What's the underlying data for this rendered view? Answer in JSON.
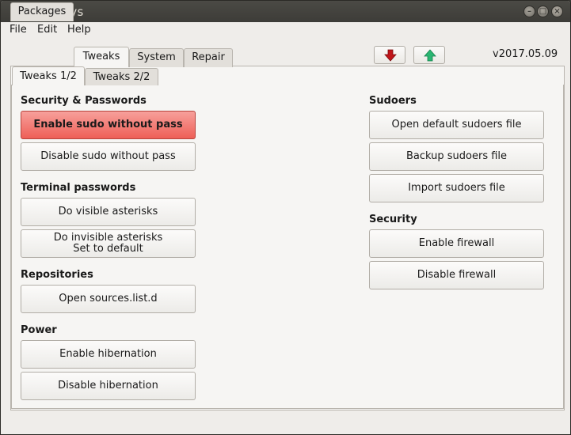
{
  "window": {
    "title": "ubunsys"
  },
  "menu": {
    "file": "File",
    "edit": "Edit",
    "help": "Help"
  },
  "tabs": {
    "packages": "Packages",
    "tweaks": "Tweaks",
    "system": "System",
    "repair": "Repair"
  },
  "subtabs": {
    "tweaks1": "Tweaks 1/2",
    "tweaks2": "Tweaks 2/2"
  },
  "version": "v2017.05.09",
  "icons": {
    "update_down": "arrow-down-red-icon",
    "update_up": "arrow-up-green-icon"
  },
  "colors": {
    "danger": "#ee5f57",
    "arrow_red": "#c0151a",
    "arrow_green": "#2bb673"
  },
  "left": {
    "security": {
      "title": "Security & Passwords",
      "enable_sudo": "Enable sudo without pass",
      "disable_sudo": "Disable sudo without pass"
    },
    "terminal": {
      "title": "Terminal passwords",
      "visible": "Do visible asterisks",
      "invisible_line1": "Do invisible asterisks",
      "invisible_line2": "Set to default"
    },
    "repos": {
      "title": "Repositories",
      "open_sources": "Open sources.list.d"
    },
    "power": {
      "title": "Power",
      "enable_hib": "Enable hibernation",
      "disable_hib": "Disable hibernation"
    }
  },
  "right": {
    "sudoers": {
      "title": "Sudoers",
      "open_default": "Open default sudoers file",
      "backup": "Backup sudoers file",
      "import": "Import sudoers file"
    },
    "security": {
      "title": "Security",
      "enable_fw": "Enable firewall",
      "disable_fw": "Disable firewall"
    }
  }
}
